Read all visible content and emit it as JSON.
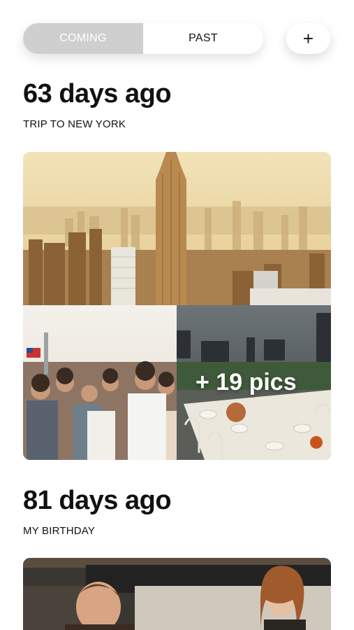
{
  "segmented": {
    "options": [
      "COMING",
      "PAST"
    ],
    "selected": "COMING"
  },
  "add_button": {
    "label": "+"
  },
  "events": [
    {
      "title": "63 days ago",
      "subtitle": "TRIP TO NEW YORK",
      "extra_pics_label": "+ 19 pics"
    },
    {
      "title": "81 days ago",
      "subtitle": "MY BIRTHDAY"
    }
  ],
  "colors": {
    "segment_active_bg": "#cfcfcf",
    "text_primary": "#111111",
    "background": "#ffffff"
  }
}
